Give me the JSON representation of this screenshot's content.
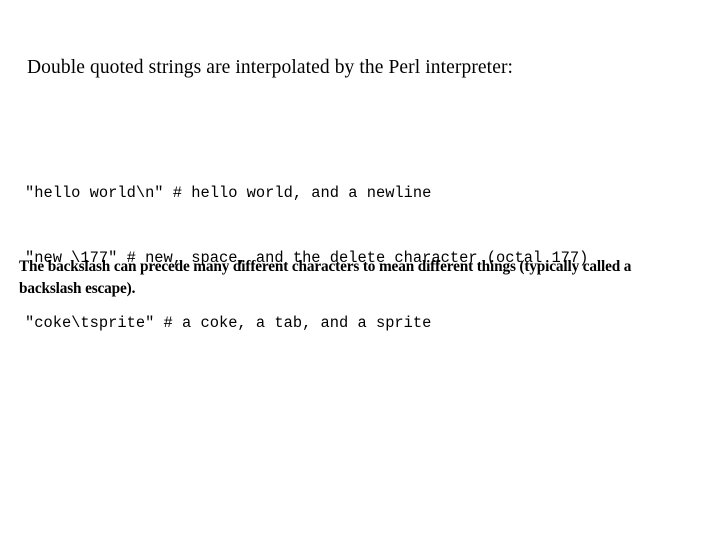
{
  "slide": {
    "background_color": "#ffffff",
    "text_color": "#000000",
    "heading": "Double quoted strings are interpolated by the Perl interpreter:",
    "code_lines": [
      "\"hello world\\n\" # hello world, and a newline",
      "\"new \\177\" # new, space, and the delete character (octal 177)",
      "\"coke\\tsprite\" # a coke, a tab, and a sprite"
    ],
    "body_paragraph": "The backslash can precede many different characters to mean different things (typically called a backslash escape)."
  }
}
